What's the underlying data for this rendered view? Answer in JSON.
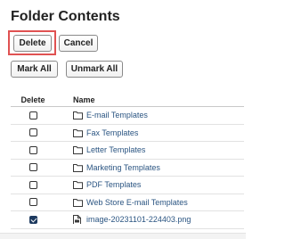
{
  "page": {
    "title": "Folder Contents"
  },
  "actions": {
    "delete_label": "Delete",
    "cancel_label": "Cancel",
    "mark_all_label": "Mark All",
    "unmark_all_label": "Unmark All"
  },
  "table": {
    "columns": {
      "delete": "Delete",
      "name": "Name"
    },
    "rows": [
      {
        "name": "E-mail Templates",
        "type": "folder",
        "checked": false
      },
      {
        "name": "Fax Templates",
        "type": "folder",
        "checked": false
      },
      {
        "name": "Letter Templates",
        "type": "folder",
        "checked": false
      },
      {
        "name": "Marketing Templates",
        "type": "folder",
        "checked": false
      },
      {
        "name": "PDF Templates",
        "type": "folder",
        "checked": false
      },
      {
        "name": "Web Store E-mail Templates",
        "type": "folder",
        "checked": false
      },
      {
        "name": "image-20231101-224403.png",
        "type": "file",
        "checked": true
      }
    ]
  },
  "colors": {
    "highlight": "#e05252",
    "link": "#2b5582",
    "checkbox_checked": "#1d3a5f"
  },
  "icons": {
    "folder": "folder-icon",
    "file": "file-icon"
  }
}
